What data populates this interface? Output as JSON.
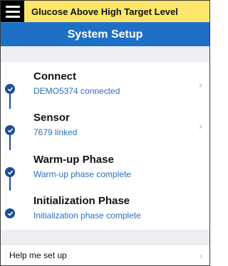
{
  "alert": {
    "text": "Glucose Above High Target Level"
  },
  "header": {
    "title": "System Setup"
  },
  "steps": [
    {
      "title": "Connect",
      "subtitle": "DEMO5374 connected",
      "status": "complete",
      "has_chevron": true
    },
    {
      "title": "Sensor",
      "subtitle": "7679 linked",
      "status": "complete",
      "has_chevron": true
    },
    {
      "title": "Warm-up Phase",
      "subtitle": "Warm-up phase complete",
      "status": "complete",
      "has_chevron": false
    },
    {
      "title": "Initialization Phase",
      "subtitle": "Initialization phase complete",
      "status": "complete",
      "has_chevron": false
    }
  ],
  "help": {
    "label": "Help me set up"
  },
  "icons": {
    "menu": "hamburger-menu-icon",
    "check": "check-circle-icon",
    "chevron": "chevron-right-icon"
  },
  "colors": {
    "alert_bg": "#fde66a",
    "header_bg": "#1e6fc6",
    "accent": "#1e4f95",
    "link_text": "#2a6fbf",
    "section_bg": "#eceef2"
  },
  "glyphs": {
    "chevron": "›"
  }
}
